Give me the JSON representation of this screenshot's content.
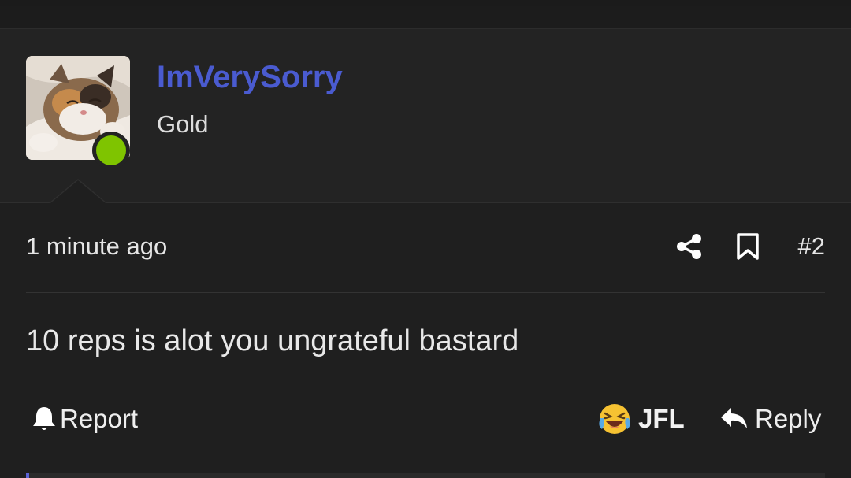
{
  "colors": {
    "username": "#4a5bd0",
    "online": "#7fc400",
    "accent": "#5b63d6"
  },
  "post": {
    "author": {
      "username": "ImVerySorry",
      "title": "Gold",
      "avatar": "kitten-avatar",
      "online": true
    },
    "timestamp": "1 minute ago",
    "number": "#2",
    "message": "10 reps is alot you ungrateful bastard",
    "actions": {
      "report_label": "Report",
      "reaction_label": "JFL",
      "reaction_icon": "laughing-crying-emoji-icon",
      "reply_label": "Reply"
    },
    "icons": {
      "share": "share-icon",
      "bookmark": "bookmark-icon",
      "report": "bell-icon",
      "reply": "reply-arrow-icon"
    }
  }
}
